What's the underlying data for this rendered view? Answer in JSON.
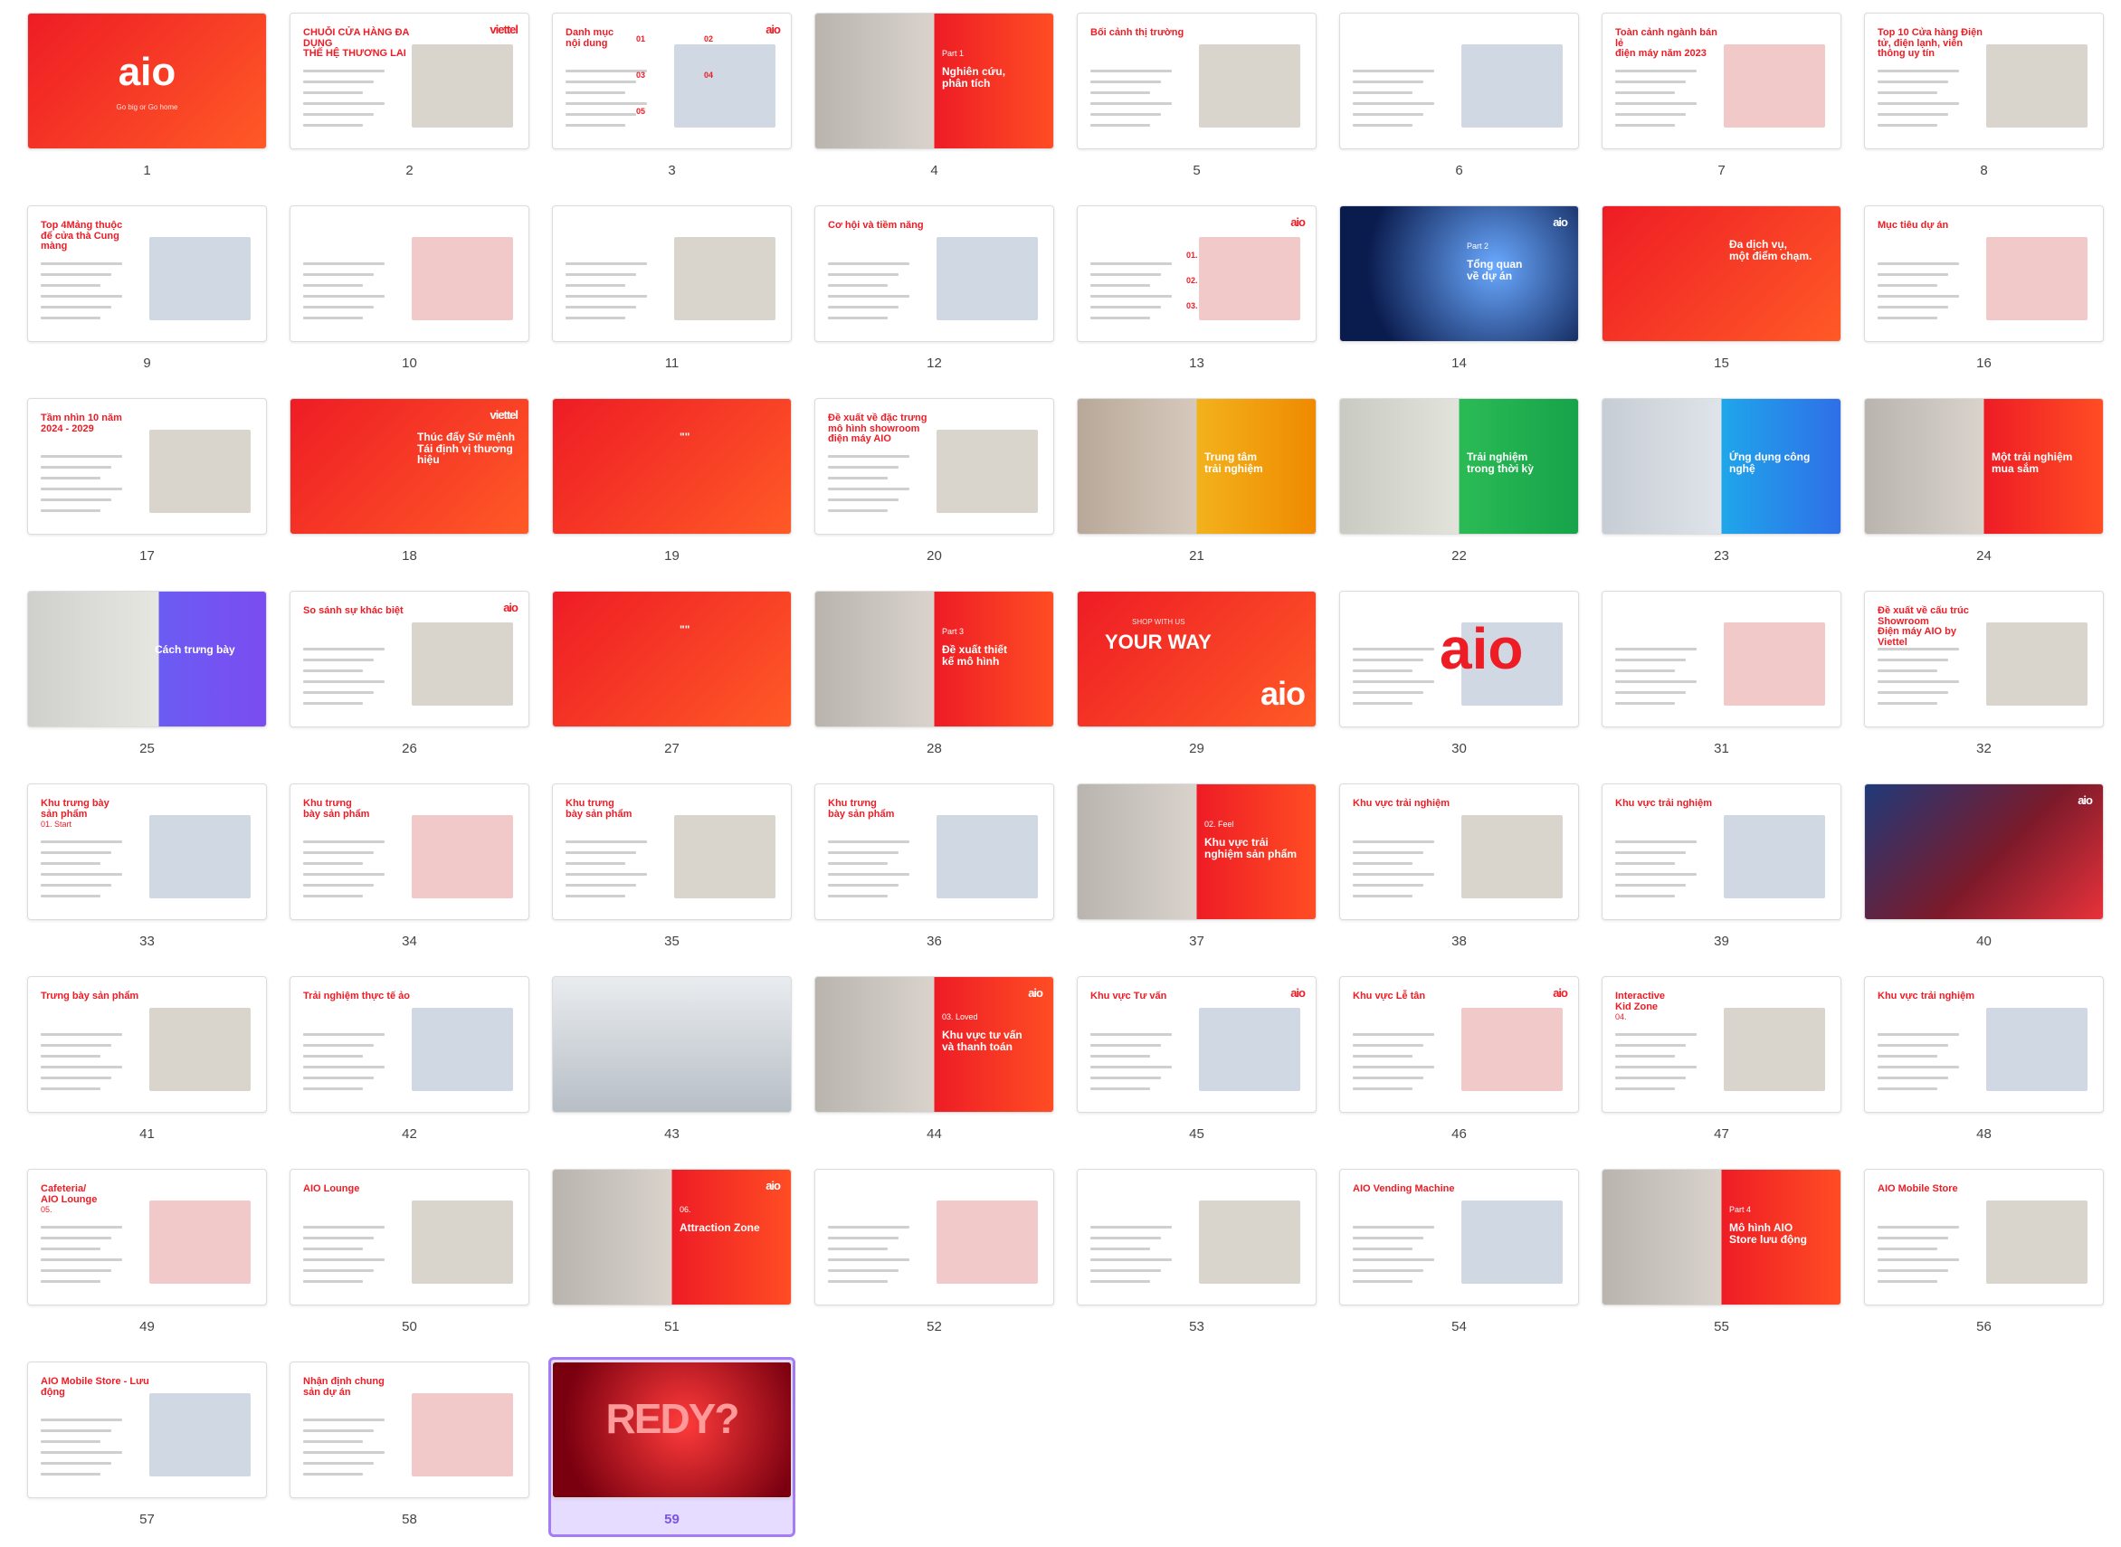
{
  "colors": {
    "brand_red": "#ee1c25",
    "brand_orange": "#ff5a26",
    "selection_purple": "#a47cf5",
    "selection_fill": "#e6dcff"
  },
  "selected_slide": "59",
  "slides": [
    {
      "num": "1",
      "style": "red",
      "title": "aio",
      "subtitle": "Go big or Go home"
    },
    {
      "num": "2",
      "style": "white",
      "title": "CHUỖI CỬA HÀNG ĐA DỤNG\nTHẾ HỆ THƯƠNG LAI",
      "logo": "viettel"
    },
    {
      "num": "3",
      "style": "white",
      "title": "Danh mục\nnội dung",
      "logo": "aio",
      "items": [
        "01",
        "02",
        "03",
        "04",
        "05"
      ]
    },
    {
      "num": "4",
      "style": "photo-red",
      "title": "Nghiên cứu,\nphân tích",
      "part": "Part 1"
    },
    {
      "num": "5",
      "style": "white",
      "title": "Bối cảnh thị trường"
    },
    {
      "num": "6",
      "style": "white",
      "title": ""
    },
    {
      "num": "7",
      "style": "white",
      "title": "Toàn cảnh ngành bán lẻ\nđiện máy năm 2023"
    },
    {
      "num": "8",
      "style": "white",
      "title": "Top 10 Cửa hàng Điện tử, điện lạnh, viễn thông uy tín"
    },
    {
      "num": "9",
      "style": "white",
      "title": "Top 4Mảng thuộc\nđể cửa thà Cung\nmàng"
    },
    {
      "num": "10",
      "style": "white",
      "title": ""
    },
    {
      "num": "11",
      "style": "white",
      "title": ""
    },
    {
      "num": "12",
      "style": "white",
      "title": "Cơ hội và tiềm năng"
    },
    {
      "num": "13",
      "style": "white",
      "title": "",
      "logo": "aio",
      "items": [
        "01.",
        "02.",
        "03."
      ]
    },
    {
      "num": "14",
      "style": "photo-blue",
      "title": "Tổng quan\nvề dự án",
      "part": "Part 2",
      "logo": "aio"
    },
    {
      "num": "15",
      "style": "red",
      "title": "Đa dịch vụ,\nmột điểm chạm."
    },
    {
      "num": "16",
      "style": "white",
      "title": "Mục tiêu dự án"
    },
    {
      "num": "17",
      "style": "white",
      "title": "Tầm nhìn 10 năm\n2024 - 2029"
    },
    {
      "num": "18",
      "style": "red",
      "title": "Thúc đẩy Sứ mệnh\nTái định vị thương hiệu",
      "logo": "viettel"
    },
    {
      "num": "19",
      "style": "red",
      "title": "\"\""
    },
    {
      "num": "20",
      "style": "white",
      "title": "Đề xuất về đặc trưng mô hình showroom điện máy AIO"
    },
    {
      "num": "21",
      "style": "photo-yellow",
      "title": "Trung tâm\ntrải nghiệm"
    },
    {
      "num": "22",
      "style": "photo-green",
      "title": "Trải nghiệm\ntrong thời kỳ"
    },
    {
      "num": "23",
      "style": "photo-blue2",
      "title": "Ứng dụng công nghệ"
    },
    {
      "num": "24",
      "style": "photo-red",
      "title": "Một trải nghiệm\nmua sắm"
    },
    {
      "num": "25",
      "style": "photo-purple",
      "title": "Cách trưng bày"
    },
    {
      "num": "26",
      "style": "white",
      "title": "So sánh sự khác biệt",
      "logo": "aio"
    },
    {
      "num": "27",
      "style": "red",
      "title": "\"\""
    },
    {
      "num": "28",
      "style": "photo-red",
      "title": "Đề xuất thiết\nkế mô hình",
      "part": "Part 3"
    },
    {
      "num": "29",
      "style": "red",
      "title": "YOUR WAY",
      "subtitle": "SHOP WITH US",
      "logo": "aio"
    },
    {
      "num": "30",
      "style": "white",
      "title": "aio"
    },
    {
      "num": "31",
      "style": "white",
      "title": ""
    },
    {
      "num": "32",
      "style": "white",
      "title": "Đề xuất về cấu trúc Showroom\nĐiện máy AIO by Viettel"
    },
    {
      "num": "33",
      "style": "white",
      "title": "Khu trưng bày\nsản phẩm",
      "tag": "01. Start"
    },
    {
      "num": "34",
      "style": "white",
      "title": "Khu trưng\nbày sản phẩm"
    },
    {
      "num": "35",
      "style": "white",
      "title": "Khu trưng\nbày sản phẩm"
    },
    {
      "num": "36",
      "style": "white",
      "title": "Khu trưng\nbày sản phẩm"
    },
    {
      "num": "37",
      "style": "photo-red",
      "title": "Khu vực trải\nnghiệm sản phẩm",
      "tag": "02. Feel"
    },
    {
      "num": "38",
      "style": "white",
      "title": "Khu vực trải nghiệm"
    },
    {
      "num": "39",
      "style": "white",
      "title": "Khu vực trải nghiệm"
    },
    {
      "num": "40",
      "style": "photo-dark",
      "title": "",
      "logo": "aio"
    },
    {
      "num": "41",
      "style": "white",
      "title": "Trưng bày sản phẩm"
    },
    {
      "num": "42",
      "style": "white",
      "title": "Trải nghiệm thực tế ảo"
    },
    {
      "num": "43",
      "style": "photo-grey",
      "title": ""
    },
    {
      "num": "44",
      "style": "photo-red",
      "title": "Khu vực tư vấn\nvà thanh toán",
      "tag": "03. Loved",
      "logo": "aio"
    },
    {
      "num": "45",
      "style": "white",
      "title": "Khu vực Tư vấn",
      "logo": "aio"
    },
    {
      "num": "46",
      "style": "white",
      "title": "Khu vực Lễ tân",
      "logo": "aio"
    },
    {
      "num": "47",
      "style": "white",
      "title": "Interactive\nKid Zone",
      "tag": "04."
    },
    {
      "num": "48",
      "style": "white",
      "title": "Khu vực trải nghiệm"
    },
    {
      "num": "49",
      "style": "white",
      "title": "Cafeteria/\nAIO Lounge",
      "tag": "05."
    },
    {
      "num": "50",
      "style": "white",
      "title": "AIO Lounge"
    },
    {
      "num": "51",
      "style": "photo-red",
      "title": "Attraction Zone",
      "tag": "06.",
      "logo": "aio"
    },
    {
      "num": "52",
      "style": "white",
      "title": ""
    },
    {
      "num": "53",
      "style": "white",
      "title": ""
    },
    {
      "num": "54",
      "style": "white",
      "title": "AIO Vending Machine"
    },
    {
      "num": "55",
      "style": "photo-red",
      "title": "Mô hình AIO\nStore lưu động",
      "tag": "Part 4"
    },
    {
      "num": "56",
      "style": "white",
      "title": "AIO Mobile Store"
    },
    {
      "num": "57",
      "style": "white",
      "title": "AIO Mobile Store - Lưu động"
    },
    {
      "num": "58",
      "style": "white",
      "title": "Nhận định chung\nsản dự án"
    },
    {
      "num": "59",
      "style": "red-dark",
      "title": "REDY?"
    }
  ]
}
